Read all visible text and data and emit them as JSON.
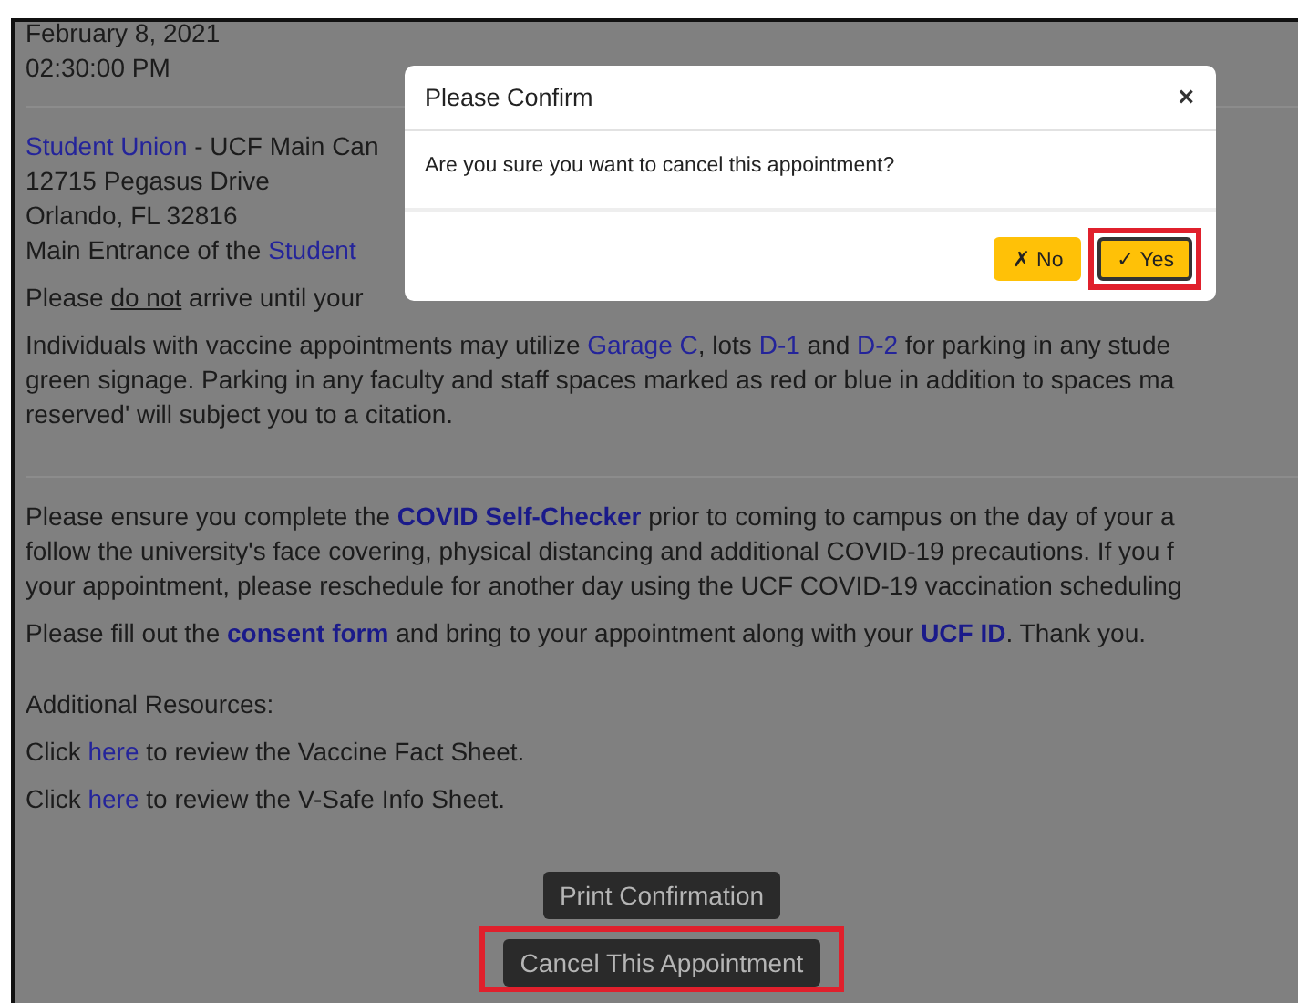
{
  "content": [
    {
      "kind": "date",
      "lines": [
        [
          {
            "t": "February 8, 2021",
            "kind": "text"
          }
        ]
      ]
    },
    {
      "kind": "time",
      "lines": [
        [
          {
            "t": "02:30:00 PM",
            "kind": "text"
          }
        ]
      ]
    },
    {
      "kind": "rule"
    },
    {
      "kind": "address",
      "lines": [
        [
          {
            "t": "Student Union",
            "kind": "link"
          },
          {
            "t": " - UCF Main Can",
            "kind": "text"
          }
        ]
      ]
    },
    {
      "kind": "address",
      "lines": [
        [
          {
            "t": "12715 Pegasus Drive",
            "kind": "text"
          }
        ]
      ]
    },
    {
      "kind": "address",
      "lines": [
        [
          {
            "t": "Orlando, FL 32816",
            "kind": "text"
          }
        ]
      ]
    },
    {
      "kind": "address",
      "lines": [
        [
          {
            "t": "Main Entrance of the ",
            "kind": "text"
          },
          {
            "t": "Student",
            "kind": "link"
          }
        ]
      ]
    },
    {
      "kind": "paragraph",
      "lines": [
        [
          {
            "t": "Please ",
            "kind": "text"
          },
          {
            "t": "do not",
            "kind": "underline"
          },
          {
            "t": " arrive until your",
            "kind": "text"
          }
        ]
      ]
    },
    {
      "kind": "paragraph",
      "lines": [
        [
          {
            "t": "Individuals with vaccine appointments may utilize ",
            "kind": "text"
          },
          {
            "t": "Garage C",
            "kind": "link"
          },
          {
            "t": ", lots ",
            "kind": "text"
          },
          {
            "t": "D-1",
            "kind": "link"
          },
          {
            "t": " and ",
            "kind": "text"
          },
          {
            "t": "D-2",
            "kind": "link"
          },
          {
            "t": " for parking in any stude",
            "kind": "text"
          }
        ],
        [
          {
            "t": "green signage. Parking in any faculty and staff spaces marked as red or blue in addition to spaces ma",
            "kind": "text"
          }
        ],
        [
          {
            "t": "reserved' will subject you to a citation.",
            "kind": "text"
          }
        ]
      ]
    },
    {
      "kind": "gap"
    },
    {
      "kind": "rule"
    },
    {
      "kind": "paragraph",
      "lines": [
        [
          {
            "t": "Please ensure you complete the ",
            "kind": "text"
          },
          {
            "t": "COVID Self-Checker",
            "kind": "strong-link"
          },
          {
            "t": " prior to coming to campus on the day of your a",
            "kind": "text"
          }
        ],
        [
          {
            "t": "follow the university's face covering, physical distancing and additional COVID-19 precautions. If you f",
            "kind": "text"
          }
        ],
        [
          {
            "t": "your appointment, please reschedule for another day using the UCF COVID-19 vaccination scheduling",
            "kind": "text"
          }
        ]
      ]
    },
    {
      "kind": "paragraph",
      "lines": [
        [
          {
            "t": "Please fill out the ",
            "kind": "text"
          },
          {
            "t": "consent form",
            "kind": "strong-link"
          },
          {
            "t": " and bring to your appointment along with your ",
            "kind": "text"
          },
          {
            "t": "UCF ID",
            "kind": "strong-link"
          },
          {
            "t": ". Thank you.",
            "kind": "text"
          }
        ]
      ]
    },
    {
      "kind": "gap"
    },
    {
      "kind": "paragraph",
      "lines": [
        [
          {
            "t": "Additional Resources:",
            "kind": "text"
          }
        ]
      ]
    },
    {
      "kind": "paragraph",
      "lines": [
        [
          {
            "t": "Click ",
            "kind": "text"
          },
          {
            "t": "here",
            "kind": "link"
          },
          {
            "t": " to review the Vaccine Fact Sheet.",
            "kind": "text"
          }
        ]
      ]
    },
    {
      "kind": "paragraph",
      "lines": [
        [
          {
            "t": "Click ",
            "kind": "text"
          },
          {
            "t": "here",
            "kind": "link"
          },
          {
            "t": " to review the V-Safe Info Sheet.",
            "kind": "text"
          }
        ]
      ]
    }
  ],
  "buttons": [
    {
      "label": "Print Confirmation",
      "highlighted": false
    },
    {
      "label": "Cancel This Appointment",
      "highlighted": true
    }
  ],
  "dialog": {
    "title": "Please Confirm",
    "close": "×",
    "message": "Are you sure you want to cancel this appointment?",
    "buttons": [
      {
        "label": "✗ No",
        "focused": false,
        "highlighted": false
      },
      {
        "label": "✓ Yes",
        "focused": true,
        "highlighted": true
      }
    ]
  }
}
